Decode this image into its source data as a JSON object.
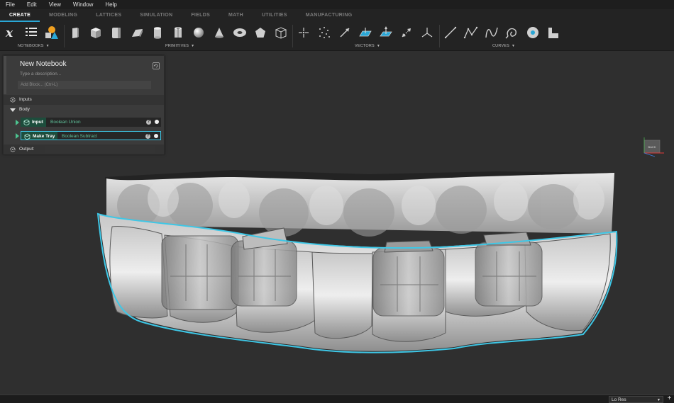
{
  "menu": [
    "File",
    "Edit",
    "View",
    "Window",
    "Help"
  ],
  "tabs": [
    {
      "label": "CREATE",
      "active": true
    },
    {
      "label": "MODELING",
      "active": false
    },
    {
      "label": "LATTICES",
      "active": false
    },
    {
      "label": "SIMULATION",
      "active": false
    },
    {
      "label": "FIELDS",
      "active": false
    },
    {
      "label": "MATH",
      "active": false
    },
    {
      "label": "UTILITIES",
      "active": false
    },
    {
      "label": "MANUFACTURING",
      "active": false
    }
  ],
  "ribbon_groups": {
    "notebooks": "NOTEBOOKS",
    "primitives": "PRIMITIVES",
    "vectors": "VECTORS",
    "curves": "CURVES"
  },
  "notebook": {
    "title": "New Notebook",
    "description_placeholder": "Type a description...",
    "add_block_placeholder": "Add Block... (Ctrl-L)",
    "inputs_label": "Inputs",
    "body_label": "Body",
    "blocks": [
      {
        "name": "Input",
        "operation": "Boolean Union",
        "selected": false
      },
      {
        "name": "Make Tray",
        "operation": "Boolean Subtract",
        "selected": true
      }
    ],
    "output_label": "Output:"
  },
  "viewcube": {
    "face_label": "BACK"
  },
  "status": {
    "resolution": "Lo Res"
  },
  "colors": {
    "accent": "#2aa7d6",
    "selection_outline": "#3ec7e6",
    "block_op": "#5fc19a"
  }
}
